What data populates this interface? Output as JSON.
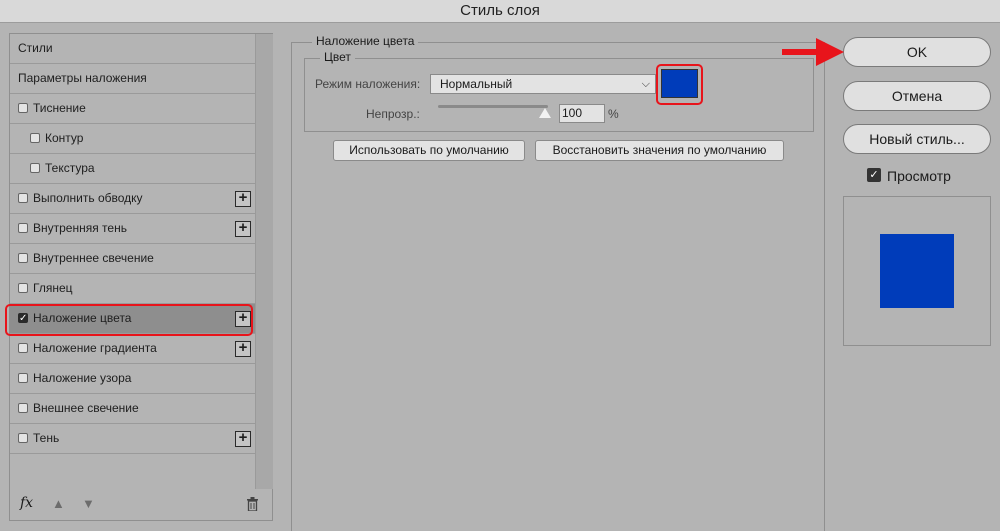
{
  "window": {
    "title": "Стиль слоя"
  },
  "styles_list": [
    {
      "label": "Стили",
      "checkbox": false,
      "checked": false,
      "indent": 0,
      "plus": false,
      "active": false
    },
    {
      "label": "Параметры наложения",
      "checkbox": false,
      "checked": false,
      "indent": 0,
      "plus": false,
      "active": false
    },
    {
      "label": "Тиснение",
      "checkbox": true,
      "checked": false,
      "indent": 0,
      "plus": false,
      "active": false
    },
    {
      "label": "Контур",
      "checkbox": true,
      "checked": false,
      "indent": 1,
      "plus": false,
      "active": false
    },
    {
      "label": "Текстура",
      "checkbox": true,
      "checked": false,
      "indent": 1,
      "plus": false,
      "active": false
    },
    {
      "label": "Выполнить обводку",
      "checkbox": true,
      "checked": false,
      "indent": 0,
      "plus": true,
      "active": false
    },
    {
      "label": "Внутренняя тень",
      "checkbox": true,
      "checked": false,
      "indent": 0,
      "plus": true,
      "active": false
    },
    {
      "label": "Внутреннее свечение",
      "checkbox": true,
      "checked": false,
      "indent": 0,
      "plus": false,
      "active": false
    },
    {
      "label": "Глянец",
      "checkbox": true,
      "checked": false,
      "indent": 0,
      "plus": false,
      "active": false
    },
    {
      "label": "Наложение цвета",
      "checkbox": true,
      "checked": true,
      "indent": 0,
      "plus": true,
      "active": true
    },
    {
      "label": "Наложение градиента",
      "checkbox": true,
      "checked": false,
      "indent": 0,
      "plus": true,
      "active": false
    },
    {
      "label": "Наложение узора",
      "checkbox": true,
      "checked": false,
      "indent": 0,
      "plus": false,
      "active": false
    },
    {
      "label": "Внешнее свечение",
      "checkbox": true,
      "checked": false,
      "indent": 0,
      "plus": false,
      "active": false
    },
    {
      "label": "Тень",
      "checkbox": true,
      "checked": false,
      "indent": 0,
      "plus": true,
      "active": false
    }
  ],
  "footer": {
    "fx_label": "fx"
  },
  "overlay": {
    "group_title": "Наложение цвета",
    "color_group_title": "Цвет",
    "blend_mode_label": "Режим наложения:",
    "blend_mode_value": "Нормальный",
    "opacity_label": "Непрозр.:",
    "opacity_value": "100",
    "opacity_unit": "%",
    "opacity_level": 1.0,
    "swatch_color": "#003cba",
    "make_default_label": "Использовать по умолчанию",
    "reset_default_label": "Восстановить значения по умолчанию"
  },
  "actions": {
    "ok_label": "OK",
    "cancel_label": "Отмена",
    "new_style_label": "Новый стиль...",
    "preview_label": "Просмотр",
    "preview_checked": true
  },
  "colors": {
    "highlight": "#e8141b",
    "overlay_color": "#003cba"
  }
}
